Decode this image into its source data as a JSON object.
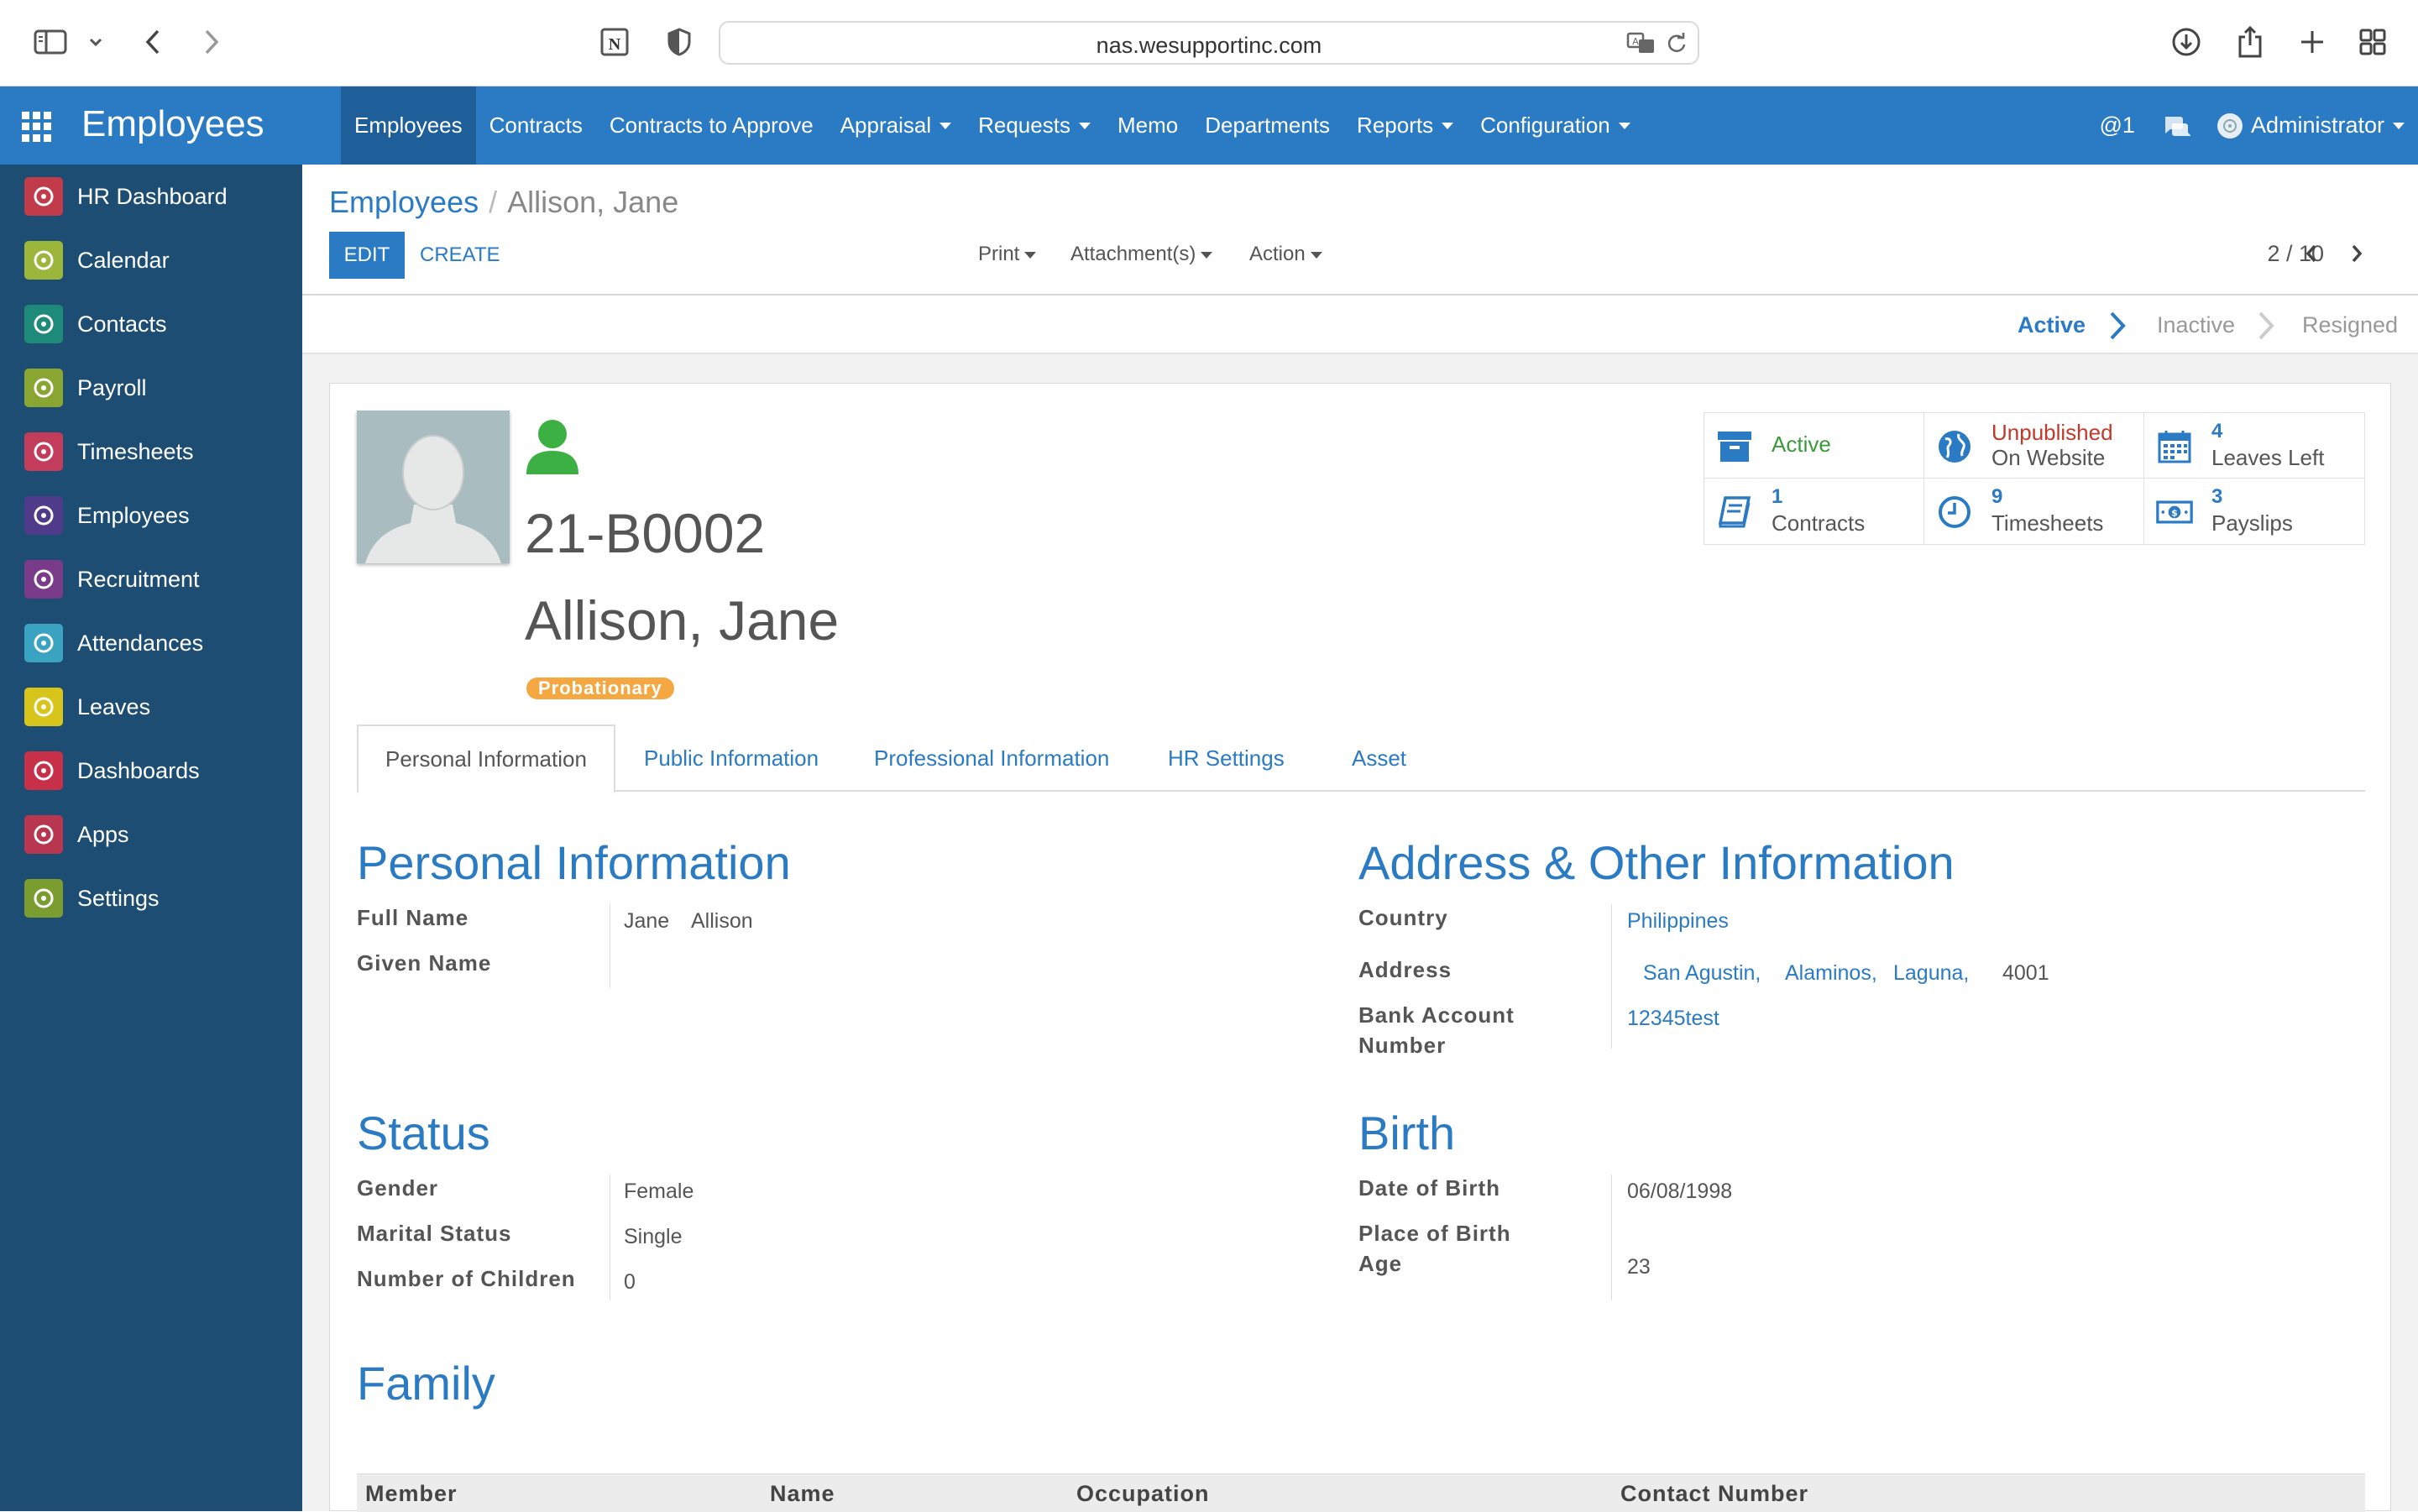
{
  "browser": {
    "url": "nas.wesupportinc.com"
  },
  "app": {
    "title": "Employees"
  },
  "nav": {
    "items": [
      {
        "label": "Employees",
        "active": true,
        "dropdown": false
      },
      {
        "label": "Contracts",
        "active": false,
        "dropdown": false
      },
      {
        "label": "Contracts to Approve",
        "active": false,
        "dropdown": false
      },
      {
        "label": "Appraisal",
        "active": false,
        "dropdown": true
      },
      {
        "label": "Requests",
        "active": false,
        "dropdown": true
      },
      {
        "label": "Memo",
        "active": false,
        "dropdown": false
      },
      {
        "label": "Departments",
        "active": false,
        "dropdown": false
      },
      {
        "label": "Reports",
        "active": false,
        "dropdown": true
      },
      {
        "label": "Configuration",
        "active": false,
        "dropdown": true
      }
    ],
    "mentions": "@1",
    "user": "Administrator"
  },
  "sidebar": {
    "items": [
      {
        "label": "HR Dashboard",
        "color": "#c23b4a"
      },
      {
        "label": "Calendar",
        "color": "#9bb63a"
      },
      {
        "label": "Contacts",
        "color": "#1e8a7a"
      },
      {
        "label": "Payroll",
        "color": "#8aa632"
      },
      {
        "label": "Timesheets",
        "color": "#c43c5c"
      },
      {
        "label": "Employees",
        "color": "#4f3b8a"
      },
      {
        "label": "Recruitment",
        "color": "#7a3b8a"
      },
      {
        "label": "Attendances",
        "color": "#3aa3c2"
      },
      {
        "label": "Leaves",
        "color": "#d7c51c"
      },
      {
        "label": "Dashboards",
        "color": "#c8304a"
      },
      {
        "label": "Apps",
        "color": "#b8364f"
      },
      {
        "label": "Settings",
        "color": "#7b9c2e"
      }
    ]
  },
  "breadcrumb": {
    "root": "Employees",
    "separator": "/",
    "current": "Allison, Jane"
  },
  "controls": {
    "edit": "EDIT",
    "create": "CREATE",
    "print": "Print",
    "attachments": "Attachment(s)",
    "action": "Action",
    "pager": "2 / 10"
  },
  "stages": {
    "items": [
      "Active",
      "Inactive",
      "Resigned"
    ],
    "current": "Active"
  },
  "employee": {
    "code": "21-B0002",
    "name": "Allison, Jane",
    "badge": "Probationary",
    "status_color": "#3cb043"
  },
  "smart_buttons": [
    {
      "value": "",
      "label": "Active",
      "value_color": "#3a9a3a",
      "icon": "archive-icon"
    },
    {
      "value": "Unpublished",
      "label": "On Website",
      "value_color": "#c0392b",
      "icon": "globe-icon"
    },
    {
      "value": "4",
      "label": "Leaves Left",
      "value_color": "#2a7ac4",
      "icon": "calendar-icon"
    },
    {
      "value": "1",
      "label": "Contracts",
      "value_color": "#2a7ac4",
      "icon": "book-icon"
    },
    {
      "value": "9",
      "label": "Timesheets",
      "value_color": "#2a7ac4",
      "icon": "clock-icon"
    },
    {
      "value": "3",
      "label": "Payslips",
      "value_color": "#2a7ac4",
      "icon": "money-icon"
    }
  ],
  "tabs": [
    "Personal Information",
    "Public Information",
    "Professional Information",
    "HR Settings",
    "Asset"
  ],
  "personal": {
    "title": "Personal Information",
    "full_name_label": "Full Name",
    "given_name_label": "Given Name",
    "first_name": "Jane",
    "last_name": "Allison"
  },
  "address": {
    "title": "Address & Other Information",
    "country_label": "Country",
    "country": "Philippines",
    "address_label": "Address",
    "street": "San Agustin,",
    "city": "Alaminos,",
    "state": "Laguna,",
    "zip": "4001",
    "bank_label_1": "Bank Account",
    "bank_label_2": "Number",
    "bank": "12345test"
  },
  "status": {
    "title": "Status",
    "gender_label": "Gender",
    "gender": "Female",
    "marital_label": "Marital Status",
    "marital": "Single",
    "children_label": "Number of Children",
    "children": "0"
  },
  "birth": {
    "title": "Birth",
    "dob_label": "Date of Birth",
    "dob": "06/08/1998",
    "pob_label": "Place of Birth",
    "age_label": "Age",
    "age": "23"
  },
  "family": {
    "title": "Family",
    "columns": [
      "Member",
      "Name",
      "Occupation",
      "Contact Number"
    ]
  }
}
